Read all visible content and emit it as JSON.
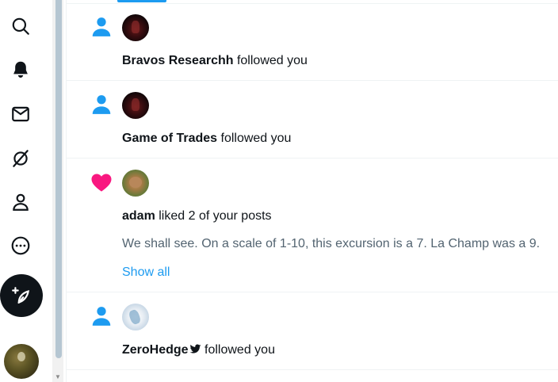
{
  "accent_color": "#1d9bf0",
  "like_color": "#f91880",
  "nav": {
    "items": [
      {
        "icon": "search-icon"
      },
      {
        "icon": "bell-icon"
      },
      {
        "icon": "mail-icon"
      },
      {
        "icon": "grok-icon"
      },
      {
        "icon": "profile-icon"
      },
      {
        "icon": "more-icon"
      }
    ],
    "compose_icon": "feather-plus-icon"
  },
  "notifications": [
    {
      "type": "follow",
      "icon": "person-icon",
      "user": "Bravos Researchh",
      "action": " followed you"
    },
    {
      "type": "follow",
      "icon": "person-icon",
      "user": "Game of Trades",
      "action": " followed you"
    },
    {
      "type": "like",
      "icon": "heart-icon",
      "user": "adam",
      "action": " liked 2 of your posts",
      "snippet": "We shall see.  On a scale of 1-10, this excursion is a 7.  La Champ was a 9.",
      "show_all": "Show all"
    },
    {
      "type": "follow",
      "icon": "person-icon",
      "user": "ZeroHedge",
      "action": " followed you",
      "verified_badge": "bird-icon"
    }
  ]
}
